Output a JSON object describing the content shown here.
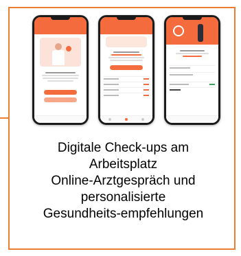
{
  "caption": {
    "line1": "Digitale Check-ups am",
    "line2": "Arbeitsplatz",
    "line3": "Online-Arztgespräch und",
    "line4": "personalisierte",
    "line5": "Gesundheits-empfehlungen"
  },
  "colors": {
    "accent": "#ED7D31",
    "app_primary": "#F46B3E"
  },
  "phones": [
    {
      "name": "onboarding-screen"
    },
    {
      "name": "dashboard-screen"
    },
    {
      "name": "results-screen"
    }
  ]
}
